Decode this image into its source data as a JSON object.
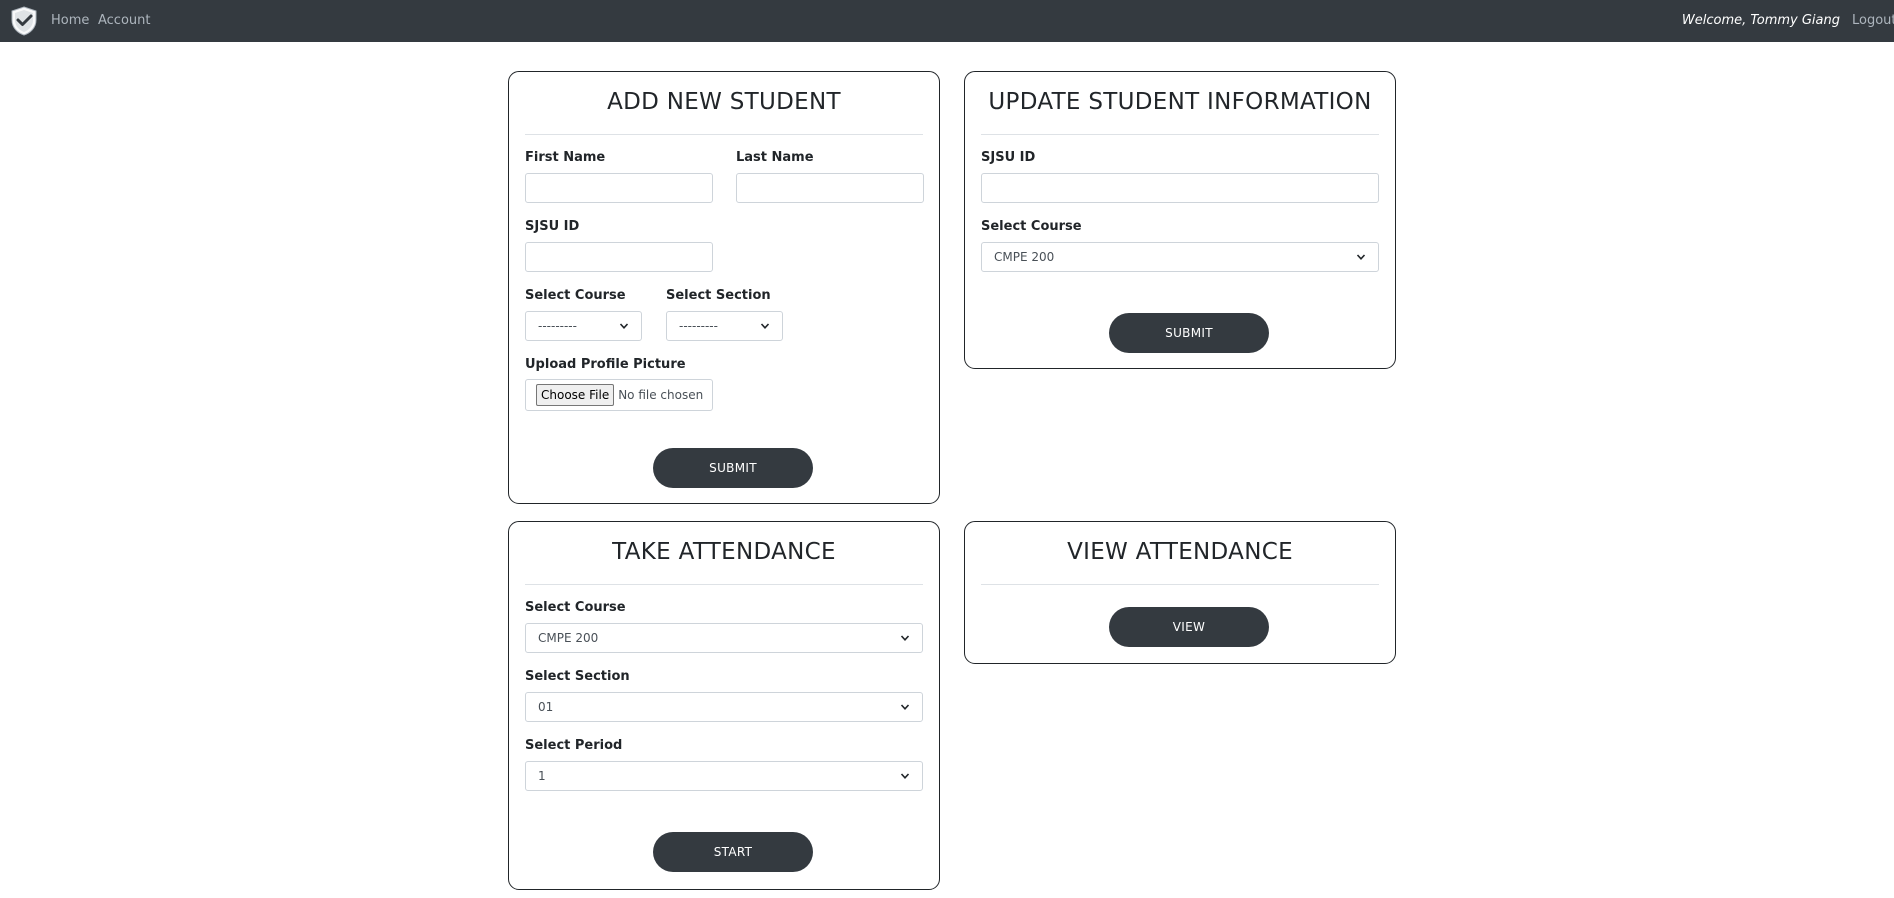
{
  "navbar": {
    "logo_icon": "shield-check-icon",
    "home": "Home",
    "account": "Account",
    "welcome": "Welcome, Tommy Giang",
    "logout": "Logout"
  },
  "add_student": {
    "title": "ADD NEW STUDENT",
    "first_name_label": "First Name",
    "first_name_value": "",
    "last_name_label": "Last Name",
    "last_name_value": "",
    "sjsu_id_label": "SJSU ID",
    "sjsu_id_value": "",
    "course_label": "Select Course",
    "course_value": "---------",
    "section_label": "Select Section",
    "section_value": "---------",
    "upload_label": "Upload Profile Picture",
    "choose_file": "Choose File",
    "file_status": "No file chosen",
    "submit": "SUBMIT"
  },
  "update_student": {
    "title": "UPDATE STUDENT INFORMATION",
    "sjsu_id_label": "SJSU ID",
    "sjsu_id_value": "",
    "course_label": "Select Course",
    "course_value": "CMPE 200",
    "submit": "SUBMIT"
  },
  "take_attendance": {
    "title": "TAKE ATTENDANCE",
    "course_label": "Select Course",
    "course_value": "CMPE 200",
    "section_label": "Select Section",
    "section_value": "01",
    "period_label": "Select Period",
    "period_value": "1",
    "start": "START"
  },
  "view_attendance": {
    "title": "VIEW ATTENDANCE",
    "view": "VIEW"
  },
  "colors": {
    "navbar_bg": "#343a40",
    "button_bg": "#343a40",
    "nav_link": "#adb5bd"
  }
}
